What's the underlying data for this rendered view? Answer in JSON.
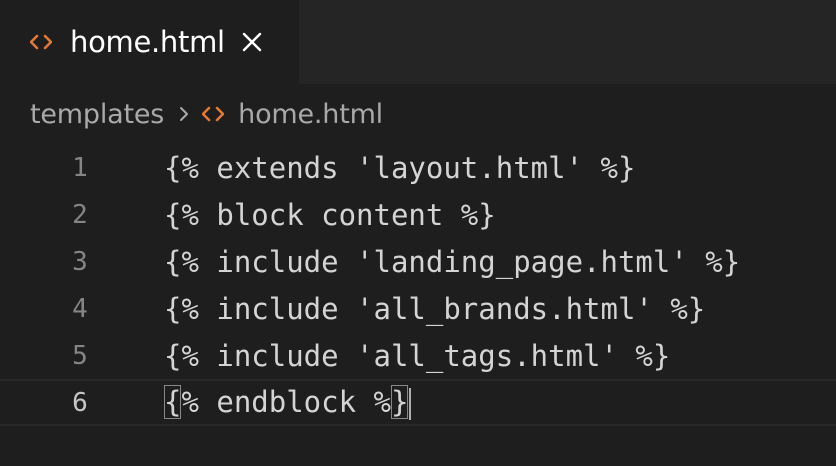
{
  "tab": {
    "label": "home.html",
    "icon": "html-code-icon",
    "close_icon": "close-icon"
  },
  "breadcrumb": {
    "folder": "templates",
    "file": "home.html"
  },
  "editor": {
    "lines": [
      {
        "number": "1",
        "code": "{% extends 'layout.html' %}"
      },
      {
        "number": "2",
        "code": "{% block content %}"
      },
      {
        "number": "3",
        "code": "{% include 'landing_page.html' %}"
      },
      {
        "number": "4",
        "code": "{% include 'all_brands.html' %}"
      },
      {
        "number": "5",
        "code": "{% include 'all_tags.html' %}"
      },
      {
        "number": "6",
        "code_open": "{",
        "code_mid": "% endblock %",
        "code_close": "}"
      }
    ]
  },
  "colors": {
    "background": "#1e1e1e",
    "tabbar": "#252526",
    "html_icon": "#e37933",
    "text": "#d4d4d4"
  }
}
